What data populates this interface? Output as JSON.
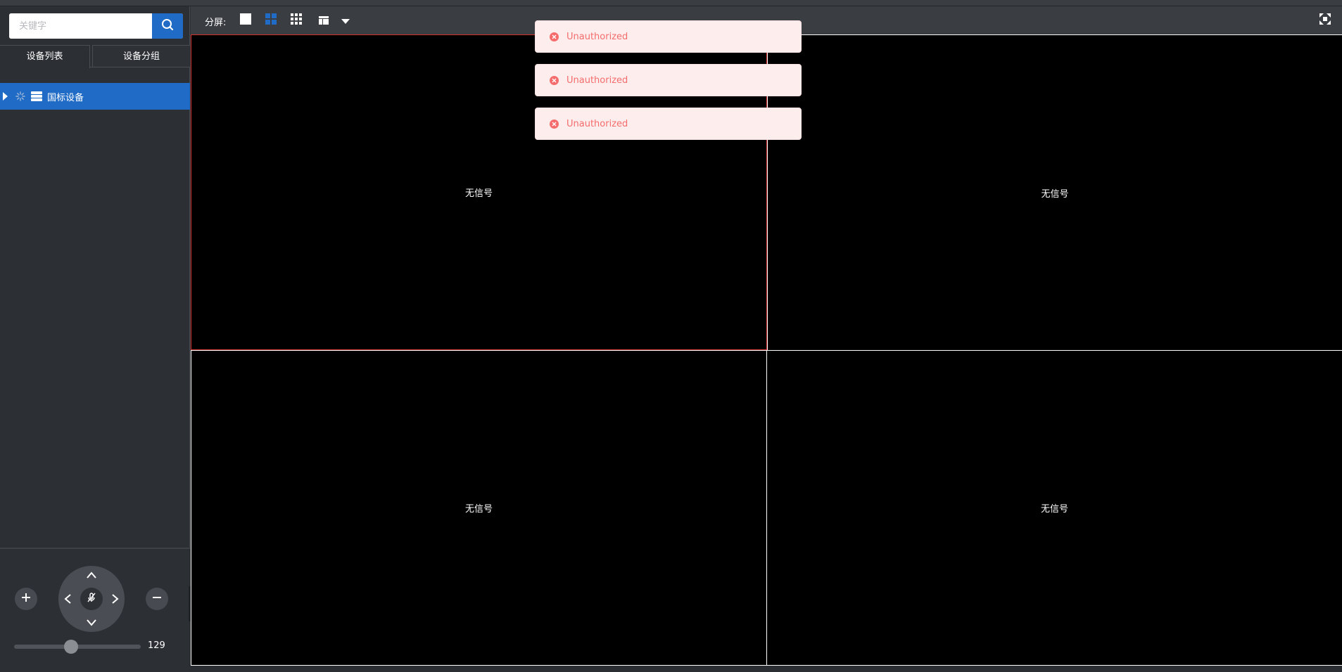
{
  "sidebar": {
    "search": {
      "placeholder": "关键字",
      "value": ""
    },
    "tabs": [
      {
        "label": "设备列表",
        "active": true
      },
      {
        "label": "设备分组",
        "active": false
      }
    ],
    "tree": [
      {
        "label": "国标设备",
        "selected": true,
        "icon": "server-list-icon"
      }
    ],
    "ptz": {
      "zoom_value": "129",
      "zoom_fraction": 0.45
    }
  },
  "toolbar": {
    "split_label": "分屏:",
    "layouts": [
      "1x1",
      "2x2",
      "3x3",
      "custom"
    ],
    "active_layout": "2x2"
  },
  "video": {
    "cells": [
      {
        "label": "无信号",
        "selected": true
      },
      {
        "label": "无信号",
        "selected": false
      },
      {
        "label": "无信号",
        "selected": false
      },
      {
        "label": "无信号",
        "selected": false
      }
    ]
  },
  "toasts": [
    {
      "message": "Unauthorized",
      "type": "error"
    },
    {
      "message": "Unauthorized",
      "type": "error"
    },
    {
      "message": "Unauthorized",
      "type": "error"
    }
  ],
  "colors": {
    "accent": "#1f6bc5",
    "error": "#f56c6c",
    "selected_border": "#d32f2f"
  }
}
